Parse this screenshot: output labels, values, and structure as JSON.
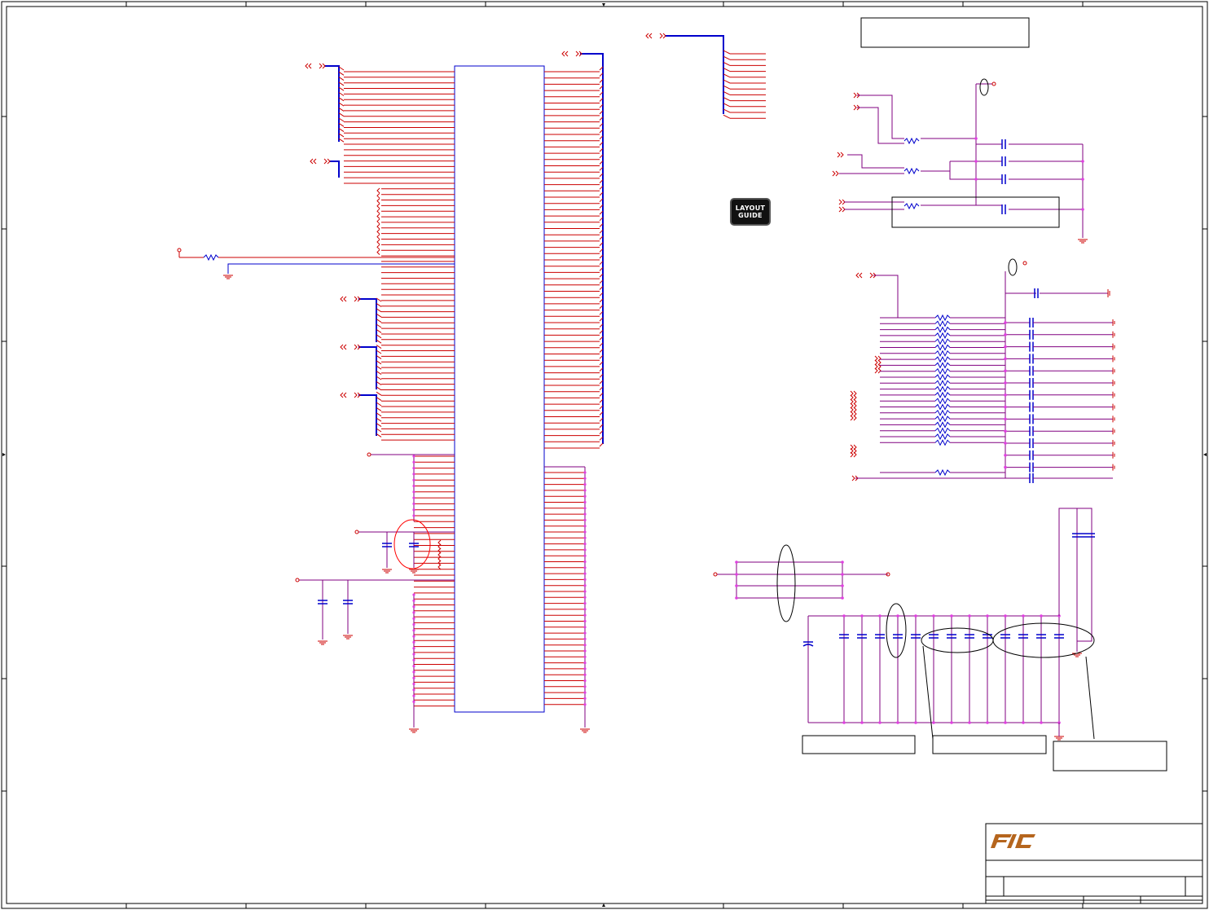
{
  "window": {
    "title": ""
  },
  "badges": {
    "layout_guide": "LAYOUT\nGUIDE"
  },
  "logo": {
    "text": "FIC",
    "color": "#b5651d"
  },
  "colors": {
    "frame": "#000000",
    "net_wire": "#cc0000",
    "bus": "#0000cc",
    "power_wire": "#800080",
    "junction": "#e040e0",
    "annotation": "#ff0000"
  },
  "icons": [
    "off-page-connector-icon",
    "ground-icon",
    "resistor-icon",
    "capacitor-icon",
    "power-port-icon",
    "layout-guide-icon"
  ]
}
